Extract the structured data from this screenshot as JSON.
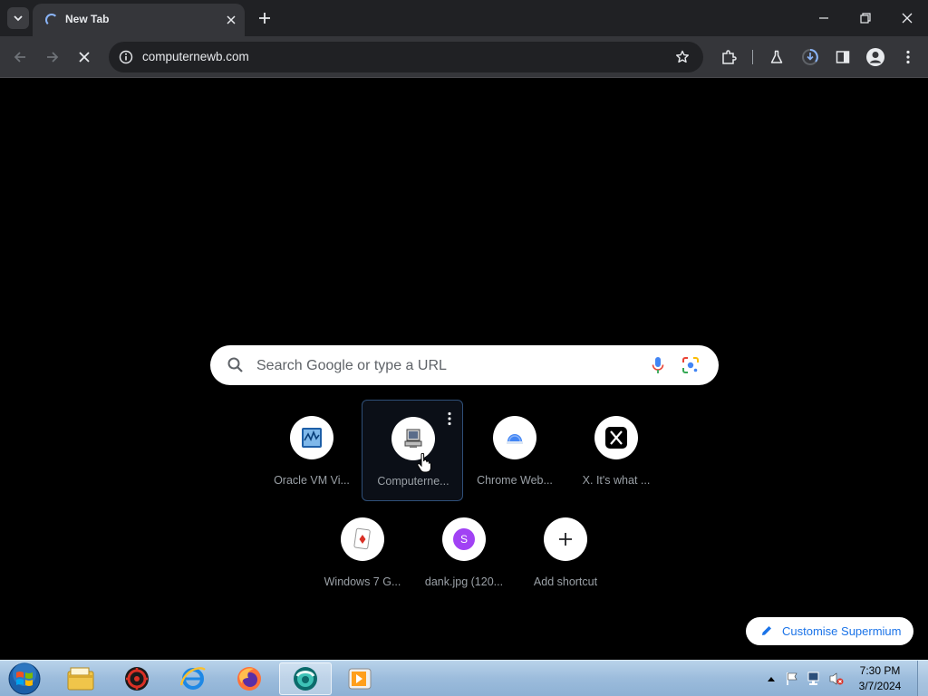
{
  "browser": {
    "tab": {
      "title": "New Tab"
    },
    "address_bar": {
      "url": "computernewb.com"
    }
  },
  "ntp": {
    "search": {
      "placeholder": "Search Google or type a URL"
    },
    "shortcuts": [
      {
        "label": "Oracle VM Vi...",
        "icon": "virtualbox-icon"
      },
      {
        "label": "Computerne...",
        "icon": "computernewb-icon",
        "focused": true
      },
      {
        "label": "Chrome Web...",
        "icon": "chrome-web-store-icon"
      },
      {
        "label": "X. It's what ...",
        "icon": "x-logo-icon"
      },
      {
        "label": "Windows 7 G...",
        "icon": "solitaire-card-icon"
      },
      {
        "label": "dank.jpg (120...",
        "icon": "letter-s-icon",
        "letter": "S"
      },
      {
        "label": "Add shortcut",
        "icon": "plus-icon"
      }
    ],
    "customise_button": {
      "label": "Customise Supermium"
    }
  },
  "taskbar": {
    "apps": [
      "file-explorer-icon",
      "app-red-gear-icon",
      "internet-explorer-icon",
      "firefox-icon",
      "supermium-icon",
      "media-player-icon"
    ],
    "clock": {
      "time": "7:30 PM",
      "date": "3/7/2024"
    }
  },
  "colors": {
    "tab_strip": "#202124",
    "toolbar": "#35363a",
    "accent": "#1a73e8",
    "focus_border": "#2f4f78",
    "shortcut_s_badge": "#a142f4"
  }
}
